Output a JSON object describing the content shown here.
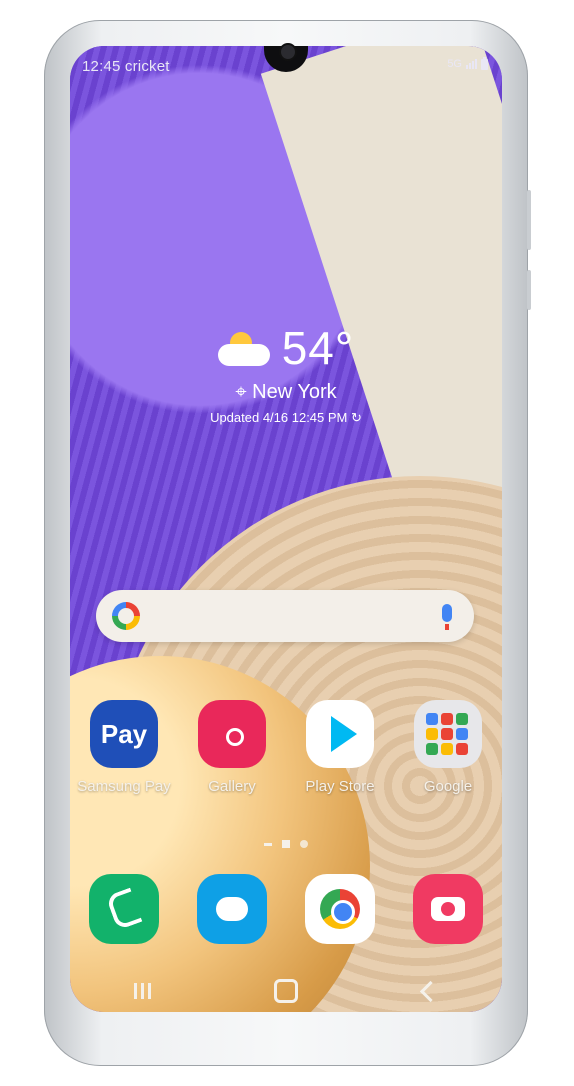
{
  "status_bar": {
    "time_carrier": "12:45 cricket",
    "network": "5G",
    "icons": [
      "signal-icon",
      "battery-icon"
    ]
  },
  "weather": {
    "icon": "partly-sunny-icon",
    "temperature": "54°",
    "location": "New York",
    "updated": "Updated 4/16 12:45 PM"
  },
  "search": {
    "google_icon": "google-g-icon",
    "mic_icon": "microphone-icon"
  },
  "home_apps": [
    {
      "label": "Samsung Pay",
      "text": "Pay"
    },
    {
      "label": "Gallery"
    },
    {
      "label": "Play Store"
    },
    {
      "label": "Google"
    }
  ],
  "dock": [
    "phone-icon",
    "messages-icon",
    "chrome-icon",
    "camera-icon"
  ],
  "nav": [
    "recent-apps-button",
    "home-button",
    "back-button"
  ],
  "colors": {
    "samsung_pay": "#1f4fb8",
    "gallery": "#e9285a",
    "phone": "#12b26b",
    "messages": "#0ea0e6",
    "camera": "#f03a62"
  }
}
